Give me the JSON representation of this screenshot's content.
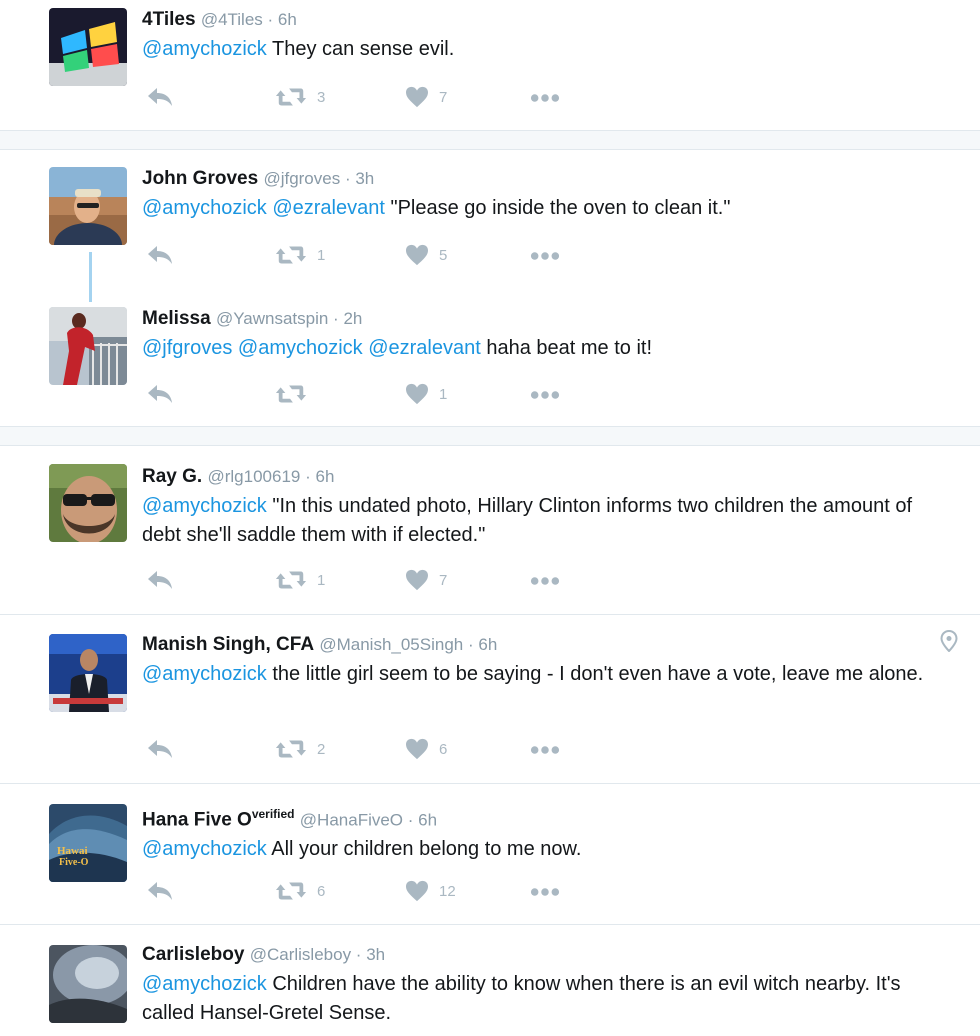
{
  "tweets": [
    {
      "name": "4Tiles",
      "handle": "@4Tiles",
      "time": "6h",
      "mention": "@amychozick",
      "text": " They can sense evil.",
      "retweets": "3",
      "likes": "7"
    },
    {
      "name": "John Groves",
      "handle": "@jfgroves",
      "time": "3h",
      "mention": "@amychozick @ezralevant",
      "text": " \"Please go inside the oven to clean it.\"",
      "retweets": "1",
      "likes": "5"
    },
    {
      "name": "Melissa",
      "handle": "@Yawnsatspin",
      "time": "2h",
      "mention": "@jfgroves @amychozick @ezralevant",
      "text": " haha beat me to it!",
      "retweets": "",
      "likes": "1"
    },
    {
      "name": "Ray G.",
      "handle": "@rlg100619",
      "time": "6h",
      "mention": "@amychozick",
      "text": " \"In this undated photo, Hillary Clinton informs two children the amount of debt she'll saddle them with if elected.\"",
      "retweets": "1",
      "likes": "7"
    },
    {
      "name": "Manish Singh, CFA",
      "handle": "@Manish_05Singh",
      "time": "6h",
      "mention": "@amychozick",
      "text": " the little girl seem to be saying - I don't even have a vote, leave me alone.",
      "retweets": "2",
      "likes": "6"
    },
    {
      "name": "Hana Five O",
      "name_sup": "verified",
      "handle": "@HanaFiveO",
      "time": "6h",
      "mention": "@amychozick",
      "text": " All your children belong to me now.",
      "retweets": "6",
      "likes": "12"
    },
    {
      "name": "Carlisleboy",
      "handle": "@Carlisleboy",
      "time": "3h",
      "mention": "@amychozick",
      "text": " Children have the ability to know when there is an evil witch nearby. It's called Hansel-Gretel Sense."
    }
  ],
  "avatar_text": {
    "hawaii_line1": "Hawai",
    "hawaii_line2": "Five-O"
  },
  "icons": {
    "reply": "reply-icon",
    "retweet": "retweet-icon",
    "like": "heart-icon",
    "more": "more-icon",
    "location": "location-pin-icon"
  },
  "colors": {
    "link": "#1b95e0",
    "muted": "#aab8c2",
    "handle": "#8899a6",
    "text": "#14171a",
    "thread": "#a4d3f0"
  }
}
